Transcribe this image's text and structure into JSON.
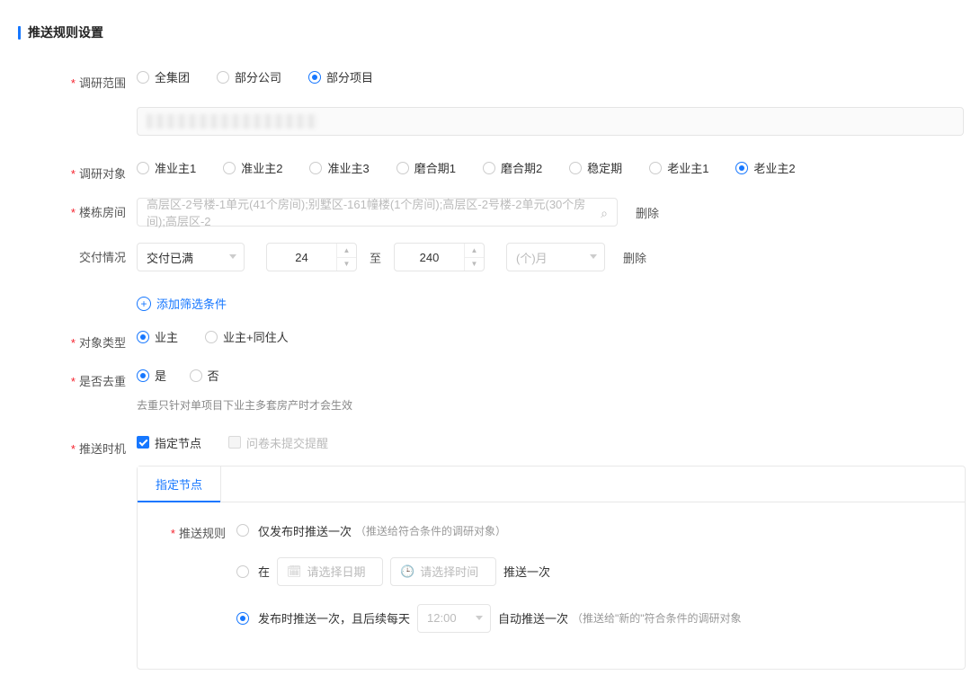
{
  "header": {
    "title": "推送规则设置"
  },
  "scope": {
    "label": "调研范围",
    "options": [
      "全集团",
      "部分公司",
      "部分项目"
    ],
    "selectedIndex": 2
  },
  "targets": {
    "label": "调研对象",
    "options": [
      "准业主1",
      "准业主2",
      "准业主3",
      "磨合期1",
      "磨合期2",
      "稳定期",
      "老业主1",
      "老业主2"
    ],
    "selectedIndex": 7
  },
  "building": {
    "label": "楼栋房间",
    "value": "高层区-2号楼-1单元(41个房间);别墅区-161幢楼(1个房间);高层区-2号楼-2单元(30个房间);高层区-2",
    "delete": "删除"
  },
  "delivery": {
    "label": "交付情况",
    "status": "交付已满",
    "from": "24",
    "to": "240",
    "toLabel": "至",
    "unit": "(个)月",
    "delete": "删除"
  },
  "addFilter": {
    "label": "添加筛选条件"
  },
  "objType": {
    "label": "对象类型",
    "options": [
      "业主",
      "业主+同住人"
    ],
    "selectedIndex": 0
  },
  "dedupe": {
    "label": "是否去重",
    "options": [
      "是",
      "否"
    ],
    "selectedIndex": 0,
    "note": "去重只针对单项目下业主多套房产时才会生效"
  },
  "timing": {
    "label": "推送时机",
    "opt1": "指定节点",
    "opt2": "问卷未提交提醒",
    "tab": "指定节点",
    "rule": {
      "label": "推送规则",
      "opt1": {
        "text": "仅发布时推送一次",
        "hint": "（推送给符合条件的调研对象）"
      },
      "opt2": {
        "prefix": "在",
        "datePlaceholder": "请选择日期",
        "timePlaceholder": "请选择时间",
        "suffix": "推送一次"
      },
      "opt3": {
        "prefix": "发布时推送一次，且后续每天",
        "time": "12:00",
        "mid": "自动推送一次",
        "hint": "（推送给\"新的\"符合条件的调研对象"
      },
      "selectedIndex": 2
    }
  }
}
